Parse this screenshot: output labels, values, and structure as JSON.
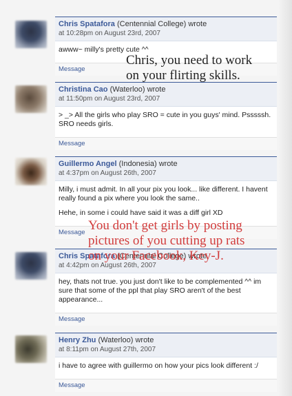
{
  "posts": [
    {
      "author": "Chris Spatafora",
      "network": "(Centennial College) wrote",
      "time": "at 10:28pm on August 23rd, 2007",
      "body": [
        "awww~ milly's pretty cute ^^"
      ],
      "action": "Message"
    },
    {
      "author": "Christina Cao",
      "network": "(Waterloo) wrote",
      "time": "at 11:50pm on August 23rd, 2007",
      "body": [
        "> _> All the girls who play SRO = cute in you guys' mind. Psssssh. SRO needs girls."
      ],
      "action": "Message"
    },
    {
      "author": "Guillermo Angel",
      "network": "(Indonesia) wrote",
      "time": "at 4:37pm on August 26th, 2007",
      "body": [
        "Milly, i must admit. In all your pix you look... like different. I havent really found a pix where you look the same..",
        "Hehe, in some i could have said it was a diff girl XD"
      ],
      "action": "Message"
    },
    {
      "author": "Chris Spatafora",
      "network": "(Centennial College) wrote",
      "time": "at 4:42pm on August 26th, 2007",
      "body": [
        "hey, thats not true. you just don't like to be complemented ^^ im sure that some of the ppl that play SRO aren't of the best appearance..."
      ],
      "action": "Message"
    },
    {
      "author": "Henry Zhu",
      "network": "(Waterloo) wrote",
      "time": "at 8:11pm on August 27th, 2007",
      "body": [
        "i have to agree with guillermo on how your pics look different :/"
      ],
      "action": "Message"
    }
  ],
  "overlays": {
    "caption_1": "Chris, you need to work\non your flirting skills.",
    "caption_2": "You don't get girls by posting\npictures of you cutting up rats\non your Facebook, Key-J."
  },
  "colors": {
    "link": "#3b5998",
    "caption_1": "#222222",
    "caption_2": "#d23c3c"
  }
}
